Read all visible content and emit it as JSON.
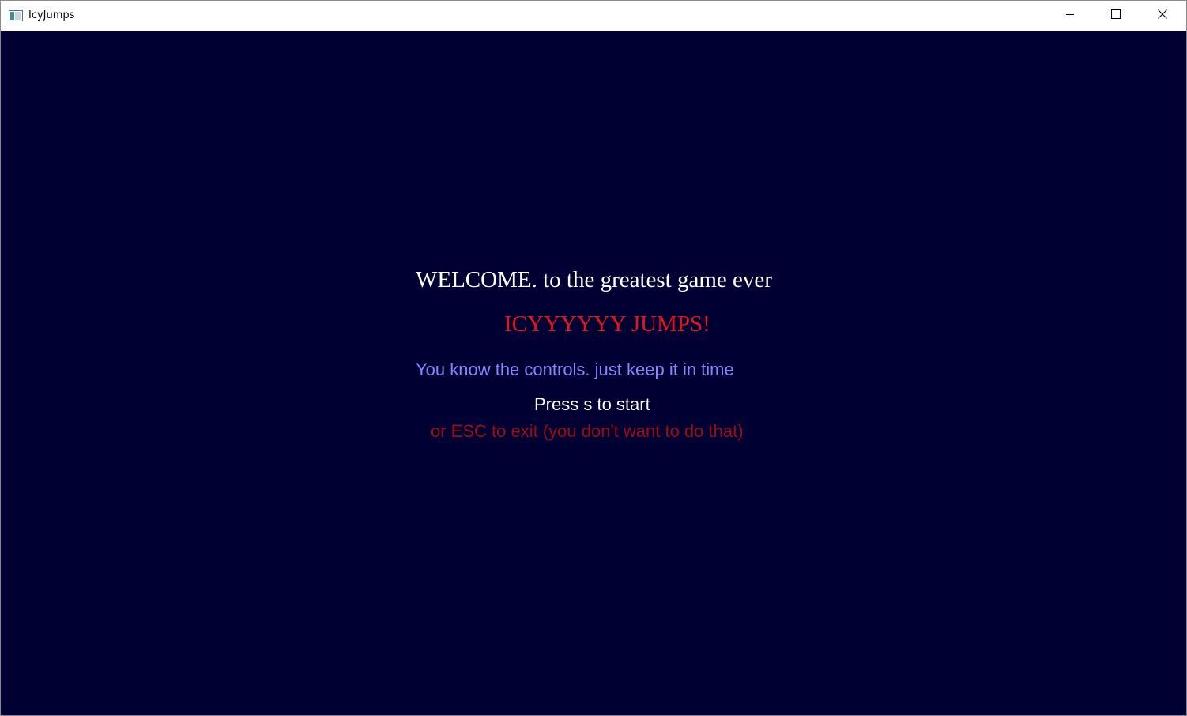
{
  "window": {
    "title": "IcyJumps",
    "icon": "app-window-icon",
    "controls": {
      "minimize_icon": "minimize-icon",
      "maximize_icon": "maximize-icon",
      "close_icon": "close-icon"
    }
  },
  "game": {
    "background_color": "#000033",
    "welcome_text": "WELCOME. to the greatest game ever",
    "game_title": "ICYYYYYY JUMPS!",
    "controls_hint": "You know the controls. just keep it in time",
    "start_prompt": "Press s to start",
    "exit_prompt": "or ESC to exit (you don't want to do that)",
    "colors": {
      "welcome": "#ffffff",
      "title": "#e8141c",
      "controls_hint": "#8686ff",
      "start_prompt": "#ffffff",
      "exit_prompt": "#9c0c14"
    }
  }
}
